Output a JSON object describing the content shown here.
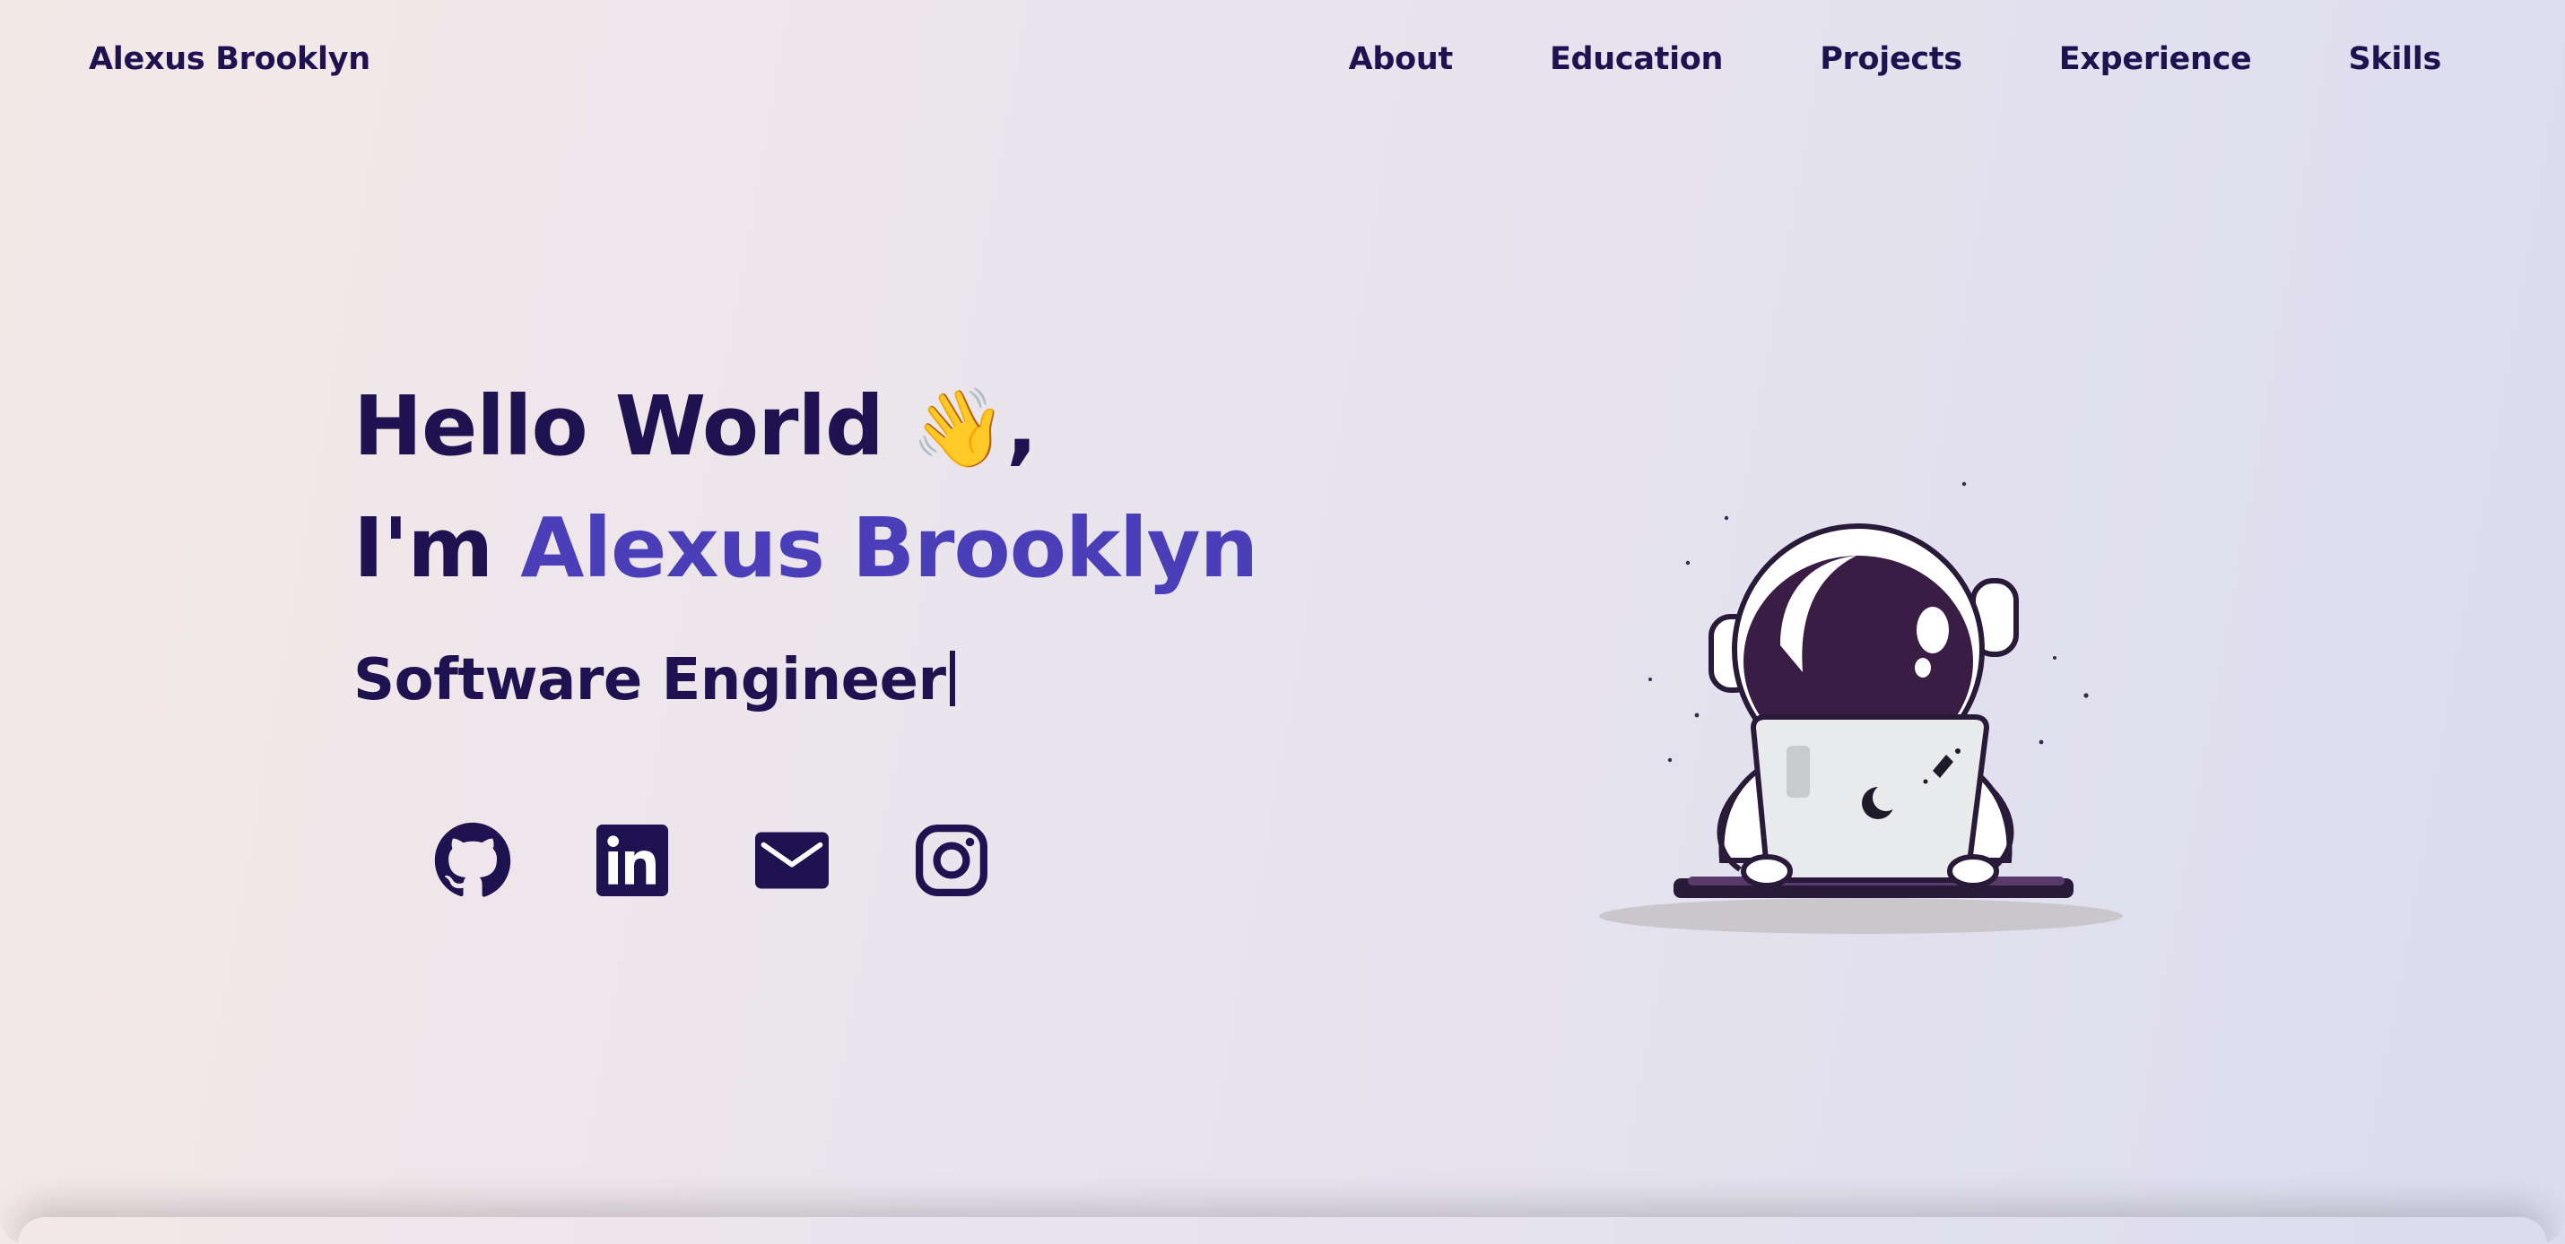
{
  "header": {
    "brand": "Alexus Brooklyn",
    "nav": [
      "About",
      "Education",
      "Projects",
      "Experience",
      "Skills"
    ]
  },
  "hero": {
    "greeting": "Hello World",
    "wave_emoji": "👋",
    "comma": ",",
    "intro_prefix": "I'm ",
    "name": "Alexus Brooklyn",
    "role": "Software Engineer"
  },
  "socials": [
    {
      "icon": "github-icon"
    },
    {
      "icon": "linkedin-icon"
    },
    {
      "icon": "mail-icon"
    },
    {
      "icon": "instagram-icon"
    }
  ],
  "illustration": {
    "icon": "astronaut-laptop-illustration"
  },
  "colors": {
    "primary": "#1f1250",
    "accent": "#4a3fb8",
    "helmet": "#3a1d45"
  }
}
